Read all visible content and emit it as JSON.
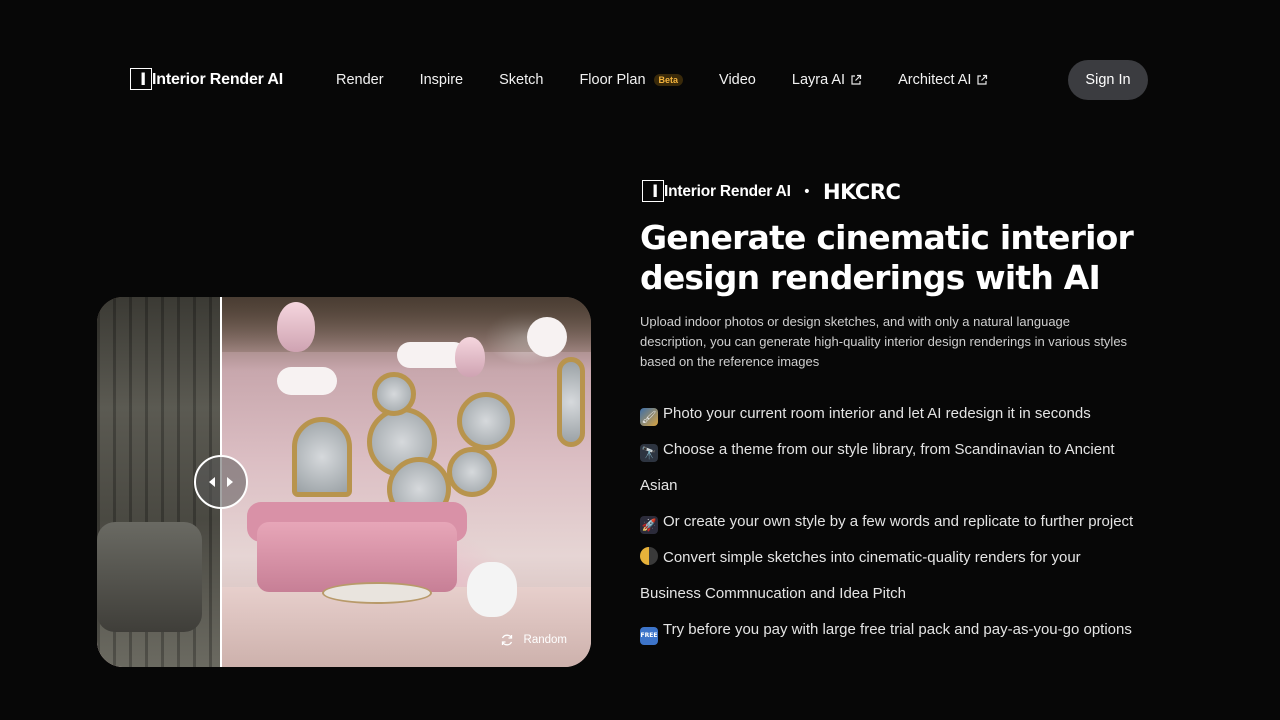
{
  "header": {
    "logo_text": "Interior Render AI",
    "nav": [
      {
        "label": "Render"
      },
      {
        "label": "Inspire"
      },
      {
        "label": "Sketch"
      },
      {
        "label": "Floor Plan",
        "badge": "Beta"
      },
      {
        "label": "Video"
      },
      {
        "label": "Layra AI",
        "external": true
      },
      {
        "label": "Architect AI",
        "external": true
      }
    ],
    "signin_label": "Sign In"
  },
  "comparison": {
    "random_label": "Random"
  },
  "hero": {
    "brand_logo_text": "Interior Render AI",
    "separator": "•",
    "partner_logo_text": "HKCRC",
    "headline": "Generate cinematic interior design renderings with AI",
    "subtitle": "Upload indoor photos or design sketches, and with only a natural language description, you can generate high-quality interior design renderings in various styles based on the reference images",
    "features": [
      {
        "icon": "paintbrush-icon",
        "text": "Photo your current room interior and let AI redesign it in seconds"
      },
      {
        "icon": "telescope-icon",
        "text": "Choose a theme from our style library, from Scandinavian to Ancient Asian"
      },
      {
        "icon": "rocket-icon",
        "text": "Or create your own style by a few words and replicate to further project"
      },
      {
        "icon": "moon-icon",
        "text": "Convert simple sketches into cinematic-quality renders for your Business Commnucation and Idea Pitch"
      },
      {
        "icon": "free-icon",
        "text": "Try before you pay with large free trial pack and pay-as-you-go options"
      }
    ]
  },
  "colors": {
    "background": "#070707",
    "signin_bg": "#3b3c40",
    "beta_badge": "#f3b33d"
  }
}
